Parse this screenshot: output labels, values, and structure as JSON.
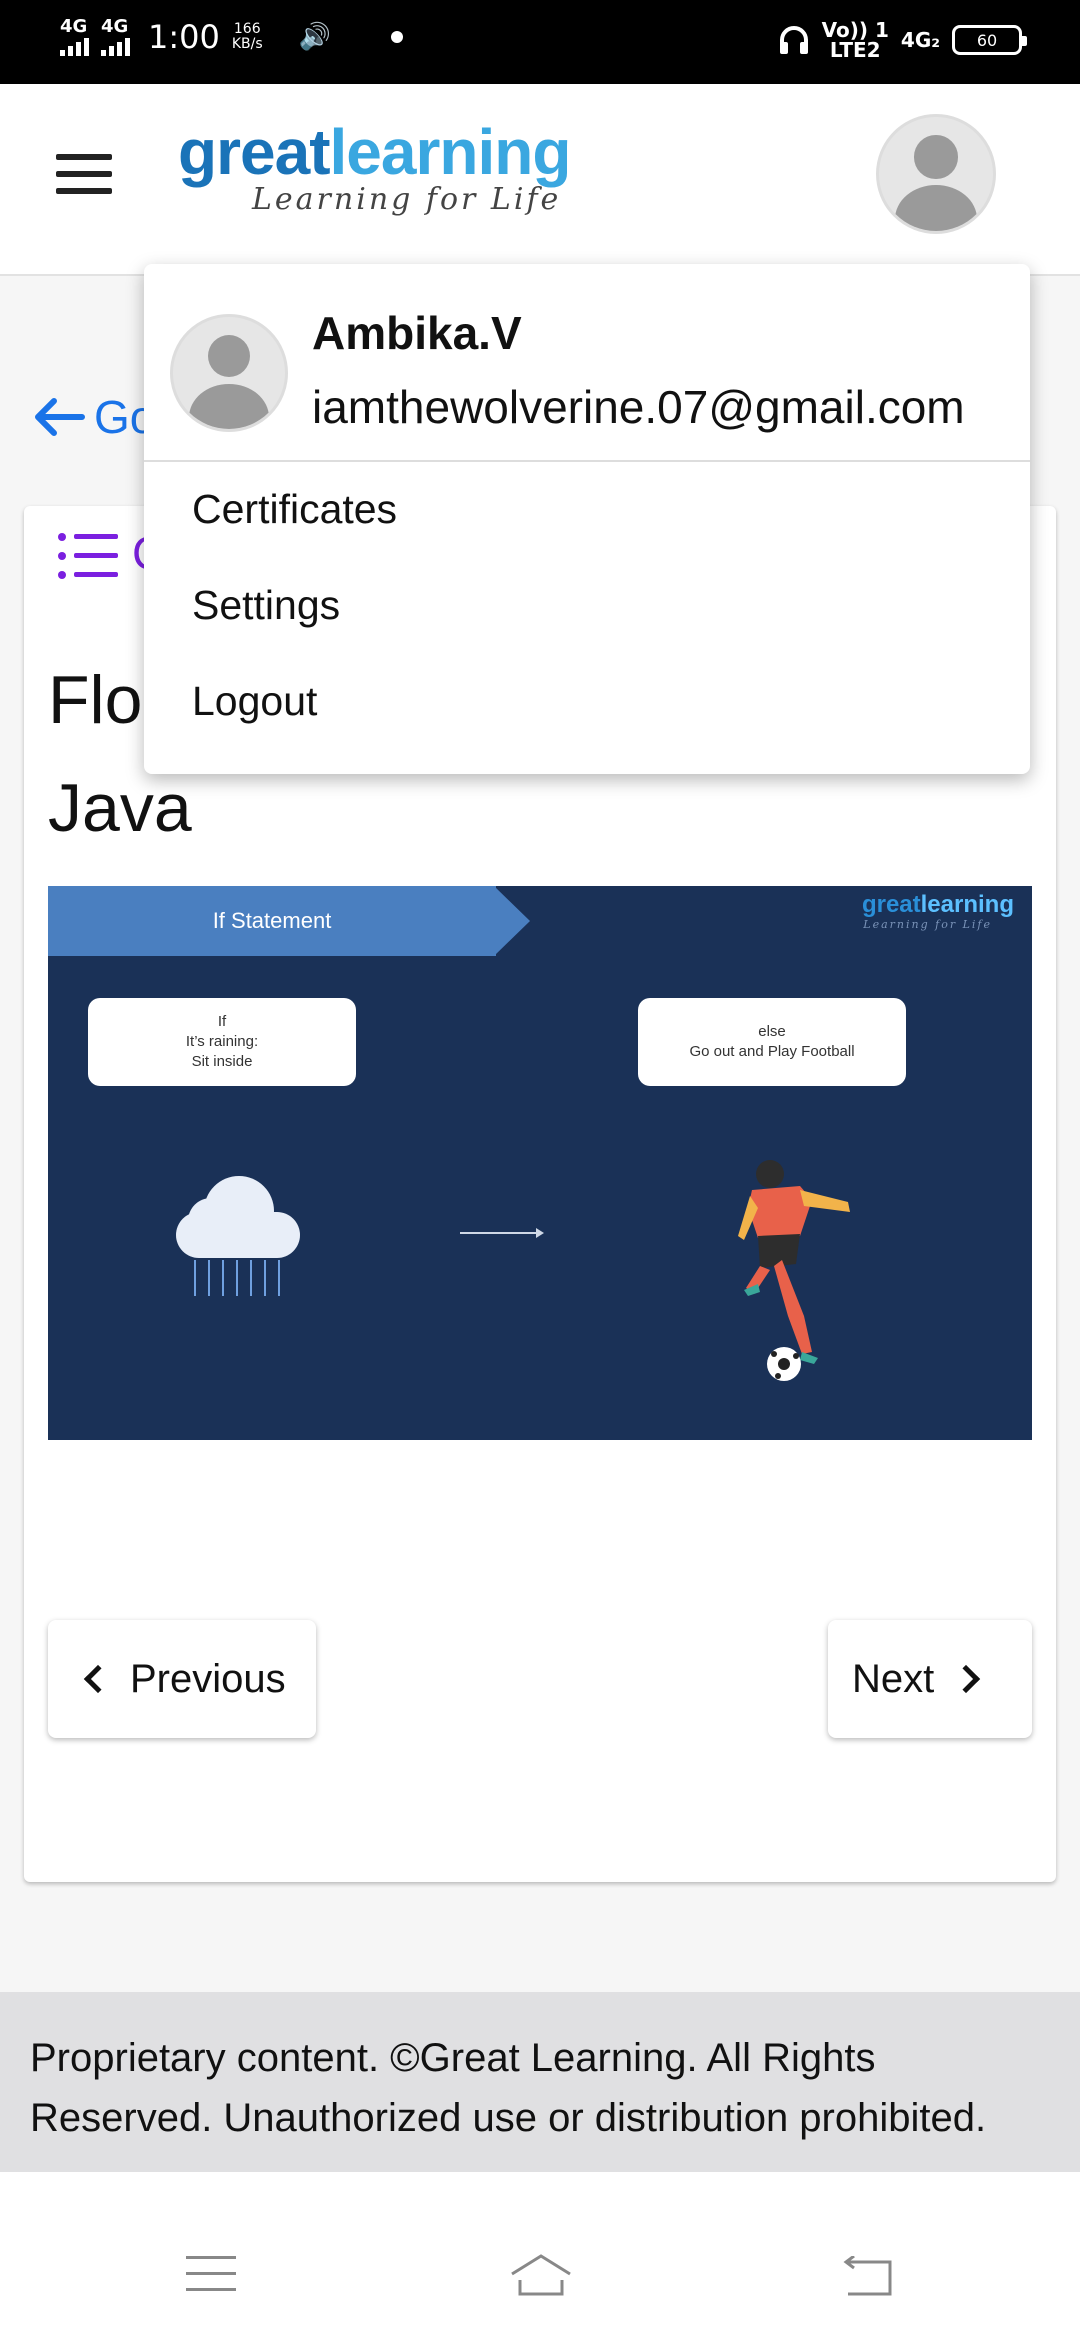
{
  "status_bar": {
    "net1": "4G",
    "net2": "4G",
    "time": "1:00",
    "speed_value": "166",
    "speed_unit": "KB/s",
    "volte": "Vo)) 1",
    "lte": "LTE2",
    "net3": "4G₂",
    "battery": "60"
  },
  "header": {
    "logo_part1": "great",
    "logo_part2": "learning",
    "logo_tagline": "Learning for Life"
  },
  "back_link": {
    "label": "Go"
  },
  "card": {
    "list_label": "C",
    "title_line1": "Flo",
    "title_line2": "Java"
  },
  "slide": {
    "banner": "If Statement",
    "logo_part1": "great",
    "logo_part2": "learning",
    "logo_tagline": "Learning for Life",
    "if_line1": "If",
    "if_line2": "It’s raining:",
    "if_line3": "Sit inside",
    "else_line1": "else",
    "else_line2": "Go out and Play Football"
  },
  "navigation": {
    "previous": "Previous",
    "next": "Next"
  },
  "footer": {
    "text": "Proprietary content. ©Great Learning. All Rights Reserved. Unauthorized use or distribution prohibited."
  },
  "dropdown": {
    "name": "Ambika.V",
    "email": "iamthewolverine.07@gmail.com",
    "items": [
      "Certificates",
      "Settings",
      "Logout"
    ]
  },
  "colors": {
    "brand_dark_blue": "#1a73b8",
    "brand_light_blue": "#3aa7e0",
    "link_blue": "#1a73e8",
    "accent_purple": "#7b1fe0",
    "slide_bg": "#1a3157"
  },
  "icons": {
    "menu": "hamburger-menu-icon",
    "back": "arrow-left-icon",
    "list": "list-icon",
    "prev": "chevron-left-icon",
    "next": "chevron-right-icon"
  }
}
